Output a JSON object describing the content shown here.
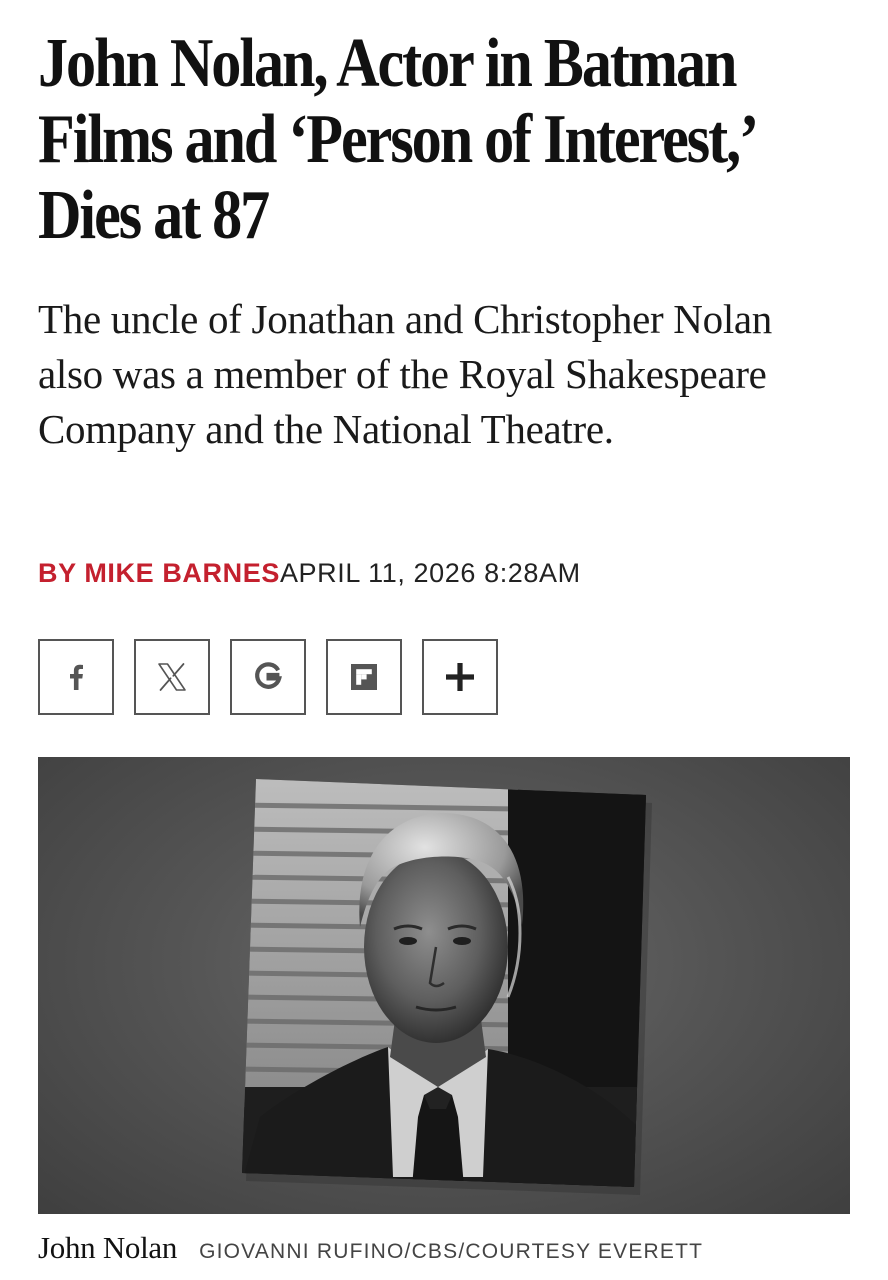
{
  "article": {
    "headline": "John Nolan, Actor in Batman Films and ‘Person of Interest,’ Dies at 87",
    "dek": "The uncle of Jonathan and Christopher Nolan also was a member of the Royal Shakespeare Company and the National Theatre.",
    "byline_prefix": "BY ",
    "author": "MIKE BARNES",
    "date": "APRIL 11, 2026 8:28AM"
  },
  "share": {
    "buttons": [
      {
        "icon": "facebook-icon",
        "glyph": "f"
      },
      {
        "icon": "x-icon",
        "glyph": "𝕏"
      },
      {
        "icon": "google-icon",
        "glyph": "G"
      },
      {
        "icon": "flipboard-icon",
        "glyph": ""
      },
      {
        "icon": "plus-icon",
        "glyph": "+"
      }
    ]
  },
  "image": {
    "caption": "John Nolan",
    "credit": "GIOVANNI RUFINO/CBS/COURTESY EVERETT"
  },
  "colors": {
    "accent": "#c4202e",
    "text": "#111111",
    "border": "#555555"
  }
}
